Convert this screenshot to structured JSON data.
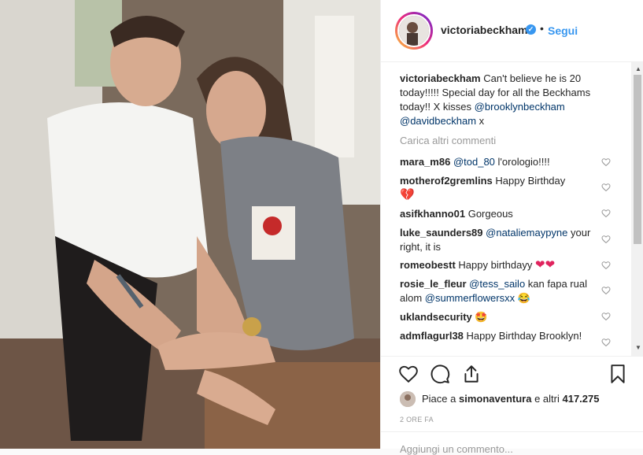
{
  "header": {
    "username": "victoriabeckham",
    "verified_mark": "✓",
    "separator": "•",
    "follow_label": "Segui"
  },
  "caption": {
    "username": "victoriabeckham",
    "text": "Can't believe he is 20 today!!!!! Special day for all the Beckhams today!! X kisses ",
    "mention1": "@brooklynbeckham",
    "mention2": "@davidbeckham",
    "tail": " x"
  },
  "load_more": "Carica altri commenti",
  "comments": [
    {
      "user": "mara_m86",
      "mention": "@tod_80",
      "text": " l'orologio!!!!",
      "emoji": ""
    },
    {
      "user": "motherof2gremlins",
      "mention": "",
      "text": " Happy Birthday",
      "emoji": "💔"
    },
    {
      "user": "asifkhanno01",
      "mention": "",
      "text": " Gorgeous",
      "emoji": ""
    },
    {
      "user": "luke_saunders89",
      "mention": "@nataliemaypyne",
      "text": " your right, it is",
      "emoji": ""
    },
    {
      "user": "romeobestt",
      "mention": "",
      "text": " Happy birthdayy",
      "emoji": "❤❤"
    },
    {
      "user": "rosie_le_fleur",
      "mention": "@tess_sailo",
      "text": " kan fapa rual alom ",
      "mention2": "@summerflowersxx",
      "emoji": "😂"
    },
    {
      "user": "uklandsecurity",
      "mention": "",
      "text": " ",
      "emoji": "🤩"
    },
    {
      "user": "admflagurl38",
      "mention": "",
      "text": " Happy Birthday Brooklyn!",
      "emoji": ""
    }
  ],
  "likes": {
    "prefix": "Piace a ",
    "user": "simonaventura",
    "middle": " e altri ",
    "count": "417.275"
  },
  "time": "2 ORE FA",
  "add_comment_placeholder": "Aggiungi un commento...",
  "icons": {
    "like": "heart-icon",
    "comment": "comment-icon",
    "share": "share-icon",
    "save": "bookmark-icon"
  },
  "colors": {
    "link": "#3897f0",
    "mention": "#003569",
    "muted": "#999999",
    "heart": "#e0245e"
  }
}
